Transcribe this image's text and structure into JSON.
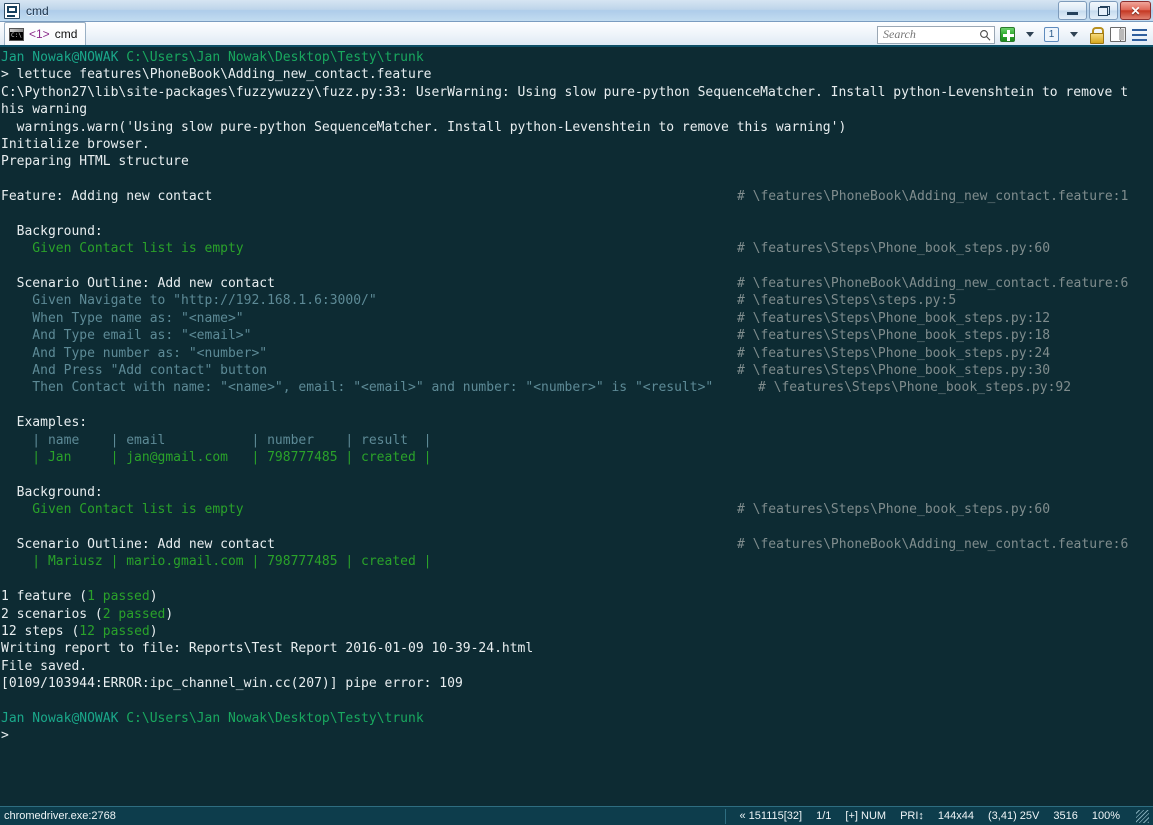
{
  "window": {
    "title": "cmd",
    "sys_icon": "console-window-icon",
    "buttons": {
      "minimize": "Minimize",
      "restore": "Restore",
      "close": "Close"
    }
  },
  "tabbar": {
    "tab": {
      "icon": "cmd-icon",
      "number": "<1>",
      "label": "cmd"
    },
    "search": {
      "placeholder": "Search",
      "value": "",
      "icon": "search-icon"
    },
    "tools": [
      {
        "name": "new-tab-button",
        "icon": "green-plus-icon"
      },
      {
        "name": "new-tab-dropdown",
        "icon": "chevron-down-icon"
      },
      {
        "name": "tab-switch-button",
        "icon": "one-icon",
        "label": "1"
      },
      {
        "name": "tab-switch-dropdown",
        "icon": "chevron-down-icon"
      },
      {
        "name": "lock-button",
        "icon": "lock-icon"
      },
      {
        "name": "toggle-panel-button",
        "icon": "panel-icon"
      },
      {
        "name": "menu-button",
        "icon": "hamburger-icon"
      }
    ]
  },
  "console": {
    "lines": [
      {
        "segs": [
          {
            "t": "Jan Nowak@NOWAK ",
            "c": "c-prompt"
          },
          {
            "t": "C:\\Users\\Jan Nowak\\Desktop\\Testy\\trunk",
            "c": "c-path"
          }
        ]
      },
      {
        "segs": [
          {
            "t": "> lettuce features\\PhoneBook\\Adding_new_contact.feature",
            "c": "c-white"
          }
        ]
      },
      {
        "segs": [
          {
            "t": "C:\\Python27\\lib\\site-packages\\fuzzywuzzy\\fuzz.py:33: UserWarning: Using slow pure-python SequenceMatcher. Install python-Levenshtein to remove t",
            "c": "c-white"
          }
        ]
      },
      {
        "segs": [
          {
            "t": "his warning",
            "c": "c-white"
          }
        ]
      },
      {
        "segs": [
          {
            "t": "  warnings.warn('Using slow pure-python SequenceMatcher. Install python-Levenshtein to remove this warning')",
            "c": "c-white"
          }
        ]
      },
      {
        "segs": [
          {
            "t": "Initialize browser.",
            "c": "c-white"
          }
        ]
      },
      {
        "segs": [
          {
            "t": "Preparing HTML structure",
            "c": "c-white"
          }
        ]
      },
      {
        "segs": []
      },
      {
        "segs": [
          {
            "t": "Feature: Adding new contact",
            "c": "c-white"
          }
        ],
        "comment": "# \\features\\PhoneBook\\Adding_new_contact.feature:1"
      },
      {
        "segs": []
      },
      {
        "segs": [
          {
            "t": "  Background:",
            "c": "c-white"
          }
        ]
      },
      {
        "segs": [
          {
            "t": "    Given Contact list is empty",
            "c": "c-green"
          }
        ],
        "comment": "# \\features\\Steps\\Phone_book_steps.py:60"
      },
      {
        "segs": []
      },
      {
        "segs": [
          {
            "t": "  Scenario Outline: Add new contact",
            "c": "c-white"
          }
        ],
        "comment": "# \\features\\PhoneBook\\Adding_new_contact.feature:6"
      },
      {
        "segs": [
          {
            "t": "    Given Navigate to \"http://192.168.1.6:3000/\"",
            "c": "c-step"
          }
        ],
        "comment": "# \\features\\Steps\\steps.py:5"
      },
      {
        "segs": [
          {
            "t": "    When Type name as: \"<name>\"",
            "c": "c-step"
          }
        ],
        "comment": "# \\features\\Steps\\Phone_book_steps.py:12"
      },
      {
        "segs": [
          {
            "t": "    And Type email as: \"<email>\"",
            "c": "c-step"
          }
        ],
        "comment": "# \\features\\Steps\\Phone_book_steps.py:18"
      },
      {
        "segs": [
          {
            "t": "    And Type number as: \"<number>\"",
            "c": "c-step"
          }
        ],
        "comment": "# \\features\\Steps\\Phone_book_steps.py:24"
      },
      {
        "segs": [
          {
            "t": "    And Press \"Add contact\" button",
            "c": "c-step"
          }
        ],
        "comment": "# \\features\\Steps\\Phone_book_steps.py:30"
      },
      {
        "segs": [
          {
            "t": "    Then Contact with name: \"<name>\", email: \"<email>\" and number: \"<number>\" is \"<result>\"",
            "c": "c-step"
          }
        ],
        "comment2": "# \\features\\Steps\\Phone_book_steps.py:92"
      },
      {
        "segs": []
      },
      {
        "segs": [
          {
            "t": "  Examples:",
            "c": "c-white"
          }
        ]
      },
      {
        "segs": [
          {
            "t": "    | name    | email           | number    | result  |",
            "c": "c-step"
          }
        ]
      },
      {
        "segs": [
          {
            "t": "    | Jan     | jan@gmail.com   | 798777485 | created |",
            "c": "c-green"
          }
        ]
      },
      {
        "segs": []
      },
      {
        "segs": [
          {
            "t": "  Background:",
            "c": "c-white"
          }
        ]
      },
      {
        "segs": [
          {
            "t": "    Given Contact list is empty",
            "c": "c-green"
          }
        ],
        "comment": "# \\features\\Steps\\Phone_book_steps.py:60"
      },
      {
        "segs": []
      },
      {
        "segs": [
          {
            "t": "  Scenario Outline: Add new contact",
            "c": "c-white"
          }
        ],
        "comment": "# \\features\\PhoneBook\\Adding_new_contact.feature:6"
      },
      {
        "segs": [
          {
            "t": "    | Mariusz | mario.gmail.com | 798777485 | created |",
            "c": "c-green"
          }
        ]
      },
      {
        "segs": []
      },
      {
        "segs": [
          {
            "t": "1 feature (",
            "c": "c-white"
          },
          {
            "t": "1 passed",
            "c": "c-green"
          },
          {
            "t": ")",
            "c": "c-white"
          }
        ]
      },
      {
        "segs": [
          {
            "t": "2 scenarios (",
            "c": "c-white"
          },
          {
            "t": "2 passed",
            "c": "c-green"
          },
          {
            "t": ")",
            "c": "c-white"
          }
        ]
      },
      {
        "segs": [
          {
            "t": "12 steps (",
            "c": "c-white"
          },
          {
            "t": "12 passed",
            "c": "c-green"
          },
          {
            "t": ")",
            "c": "c-white"
          }
        ]
      },
      {
        "segs": [
          {
            "t": "Writing report to file: Reports\\Test Report 2016-01-09 10-39-24.html",
            "c": "c-white"
          }
        ]
      },
      {
        "segs": [
          {
            "t": "File saved.",
            "c": "c-white"
          }
        ]
      },
      {
        "segs": [
          {
            "t": "[0109/103944:ERROR:ipc_channel_win.cc(207)] pipe error: 109",
            "c": "c-white"
          }
        ]
      },
      {
        "segs": []
      },
      {
        "segs": [
          {
            "t": "Jan Nowak@NOWAK ",
            "c": "c-prompt"
          },
          {
            "t": "C:\\Users\\Jan Nowak\\Desktop\\Testy\\trunk",
            "c": "c-path"
          }
        ]
      },
      {
        "segs": [
          {
            "t": ">",
            "c": "c-white"
          }
        ]
      }
    ]
  },
  "statusbar": {
    "left": "chromedriver.exe:2768",
    "right": [
      "« 151115[32]",
      "1/1",
      "[+] NUM",
      "PRI↕",
      "144x44",
      "(3,41) 25V",
      "3516",
      "100%"
    ]
  }
}
